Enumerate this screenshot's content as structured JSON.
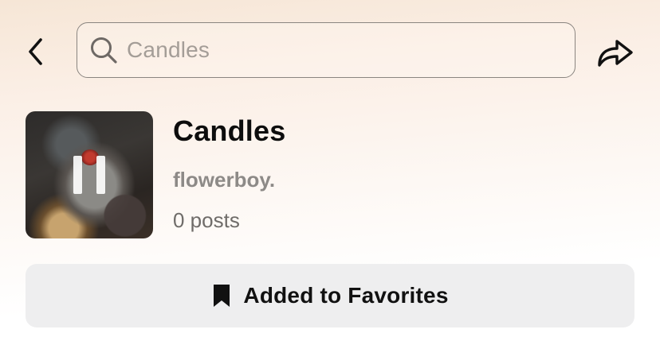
{
  "header": {
    "back_icon": "chevron-left-icon",
    "search": {
      "icon": "search-icon",
      "value": "Candles"
    },
    "share_icon": "share-arrow-icon"
  },
  "collection": {
    "title": "Candles",
    "author": "flowerboy.",
    "posts_count": "0 posts",
    "thumbnail_overlay_icon": "pause-icon"
  },
  "favorites_button": {
    "icon": "bookmark-icon",
    "label": "Added to Favorites",
    "background": "#eeeeef"
  },
  "colors": {
    "text_primary": "#111111",
    "text_secondary": "#8d8a87",
    "search_placeholder": "#a49d97"
  }
}
